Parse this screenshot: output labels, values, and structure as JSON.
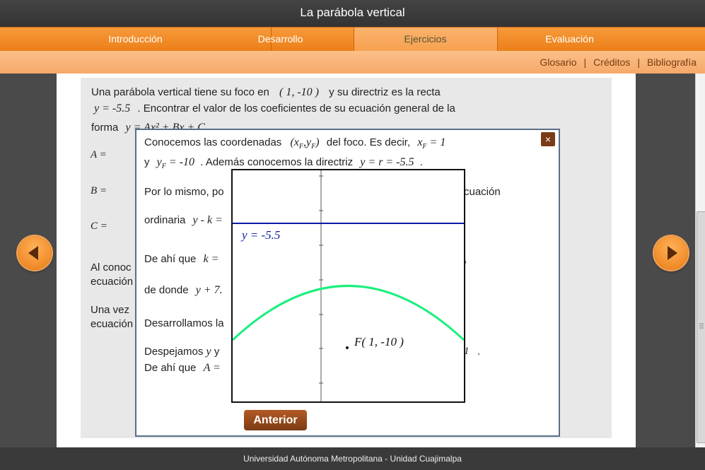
{
  "window": {
    "title": "La parábola vertical"
  },
  "nav": {
    "tabs": [
      {
        "label": "Introducción"
      },
      {
        "label": "Desarrollo"
      },
      {
        "label": "Ejercicios"
      },
      {
        "label": "Evaluación"
      }
    ],
    "active": "Ejercicios"
  },
  "subnav": {
    "glosario": "Glosario",
    "creditos": "Créditos",
    "bibliografia": "Bibliografía",
    "separator": "|"
  },
  "problem": {
    "line1_a": "Una parábola vertical tiene su foco en",
    "focus": "( 1, -10 )",
    "line1_b": "y su directriz es la recta",
    "directrix": "y = -5.5",
    "line2": ". Encontrar el valor de los coeficientes de su ecuación general de la",
    "line3": "forma",
    "general_eq": "y = Ax² + Bx + C",
    "label_a": "A =",
    "label_b": "B =",
    "label_c": "C =",
    "p4a": "Al conoc",
    "p4b": "ecuación",
    "p5a": "Una vez",
    "p5b": "ecuación"
  },
  "dialog": {
    "l1": "Conocemos las coordenadas",
    "l1_coords": "(x",
    "l1_sub": "F",
    "l1_mid": ",y",
    "l1_sub2": "F",
    "l1_close": ")",
    "l1_b": "del foco. Es decir,",
    "l1_x": "x",
    "l1_xsub": "F",
    "l1_xval": "= 1",
    "l2_a": "y",
    "l2_y": "y",
    "l2_ysub": "F",
    "l2_yval": "= -10",
    "l2_b": ". Además conocemos la directriz",
    "l2_dir": "y = r = -5.5",
    "l2_end": ".",
    "l3_a": "Por lo mismo, po",
    "l3_b": "cuación",
    "l4_a": "ordinaria",
    "l4_eq": "y - k =",
    "l5_a": "De ahí que",
    "l5_eq": "k =",
    "l5_end": ",",
    "l6_a": "de donde",
    "l6_eq": "y + 7.",
    "l7_a": "Desarrollamos la",
    "l8_a": "Despejamos",
    "l8_y": "y",
    "l8_b": "y",
    "l8_end": "1",
    "l8_dot": ".",
    "l9_a": "De ahí que",
    "l9_eq": "A =",
    "close_icon": "×",
    "anterior": "Anterior"
  },
  "graph": {
    "directrix_label": "y = -5.5",
    "focus_label": "F( 1, -10 )",
    "directrix_color": "#0a1aa8",
    "parabola_color": "#19f07c"
  },
  "footer": {
    "text": "Universidad Autónoma Metropolitana - Unidad Cuajimalpa"
  },
  "colors": {
    "accent": "#ec7f18",
    "button": "#7c3b12"
  }
}
